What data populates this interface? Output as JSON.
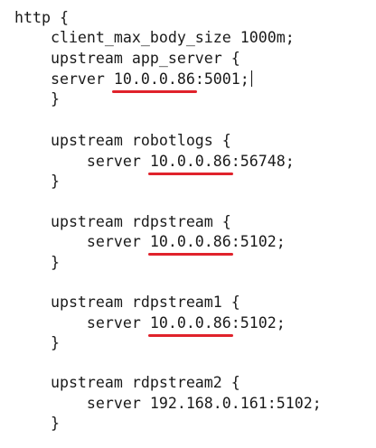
{
  "editor": {
    "lines": [
      {
        "text": "http {"
      },
      {
        "text": "    client_max_body_size 1000m;"
      },
      {
        "text": "    upstream app_server {"
      },
      {
        "pre": "    server ",
        "ip": "10.0.0.86",
        "post": ":5001;",
        "caret": true
      },
      {
        "text": "    }"
      },
      {
        "text": ""
      },
      {
        "text": "    upstream robotlogs {"
      },
      {
        "pre": "        server ",
        "ip": "10.0.0.86",
        "post": ":56748;"
      },
      {
        "text": "    }"
      },
      {
        "text": ""
      },
      {
        "text": "    upstream rdpstream {"
      },
      {
        "pre": "        server ",
        "ip": "10.0.0.86",
        "post": ":5102;"
      },
      {
        "text": "    }"
      },
      {
        "text": ""
      },
      {
        "text": "    upstream rdpstream1 {"
      },
      {
        "pre": "        server ",
        "ip": "10.0.0.86",
        "post": ":5102;"
      },
      {
        "text": "    }"
      },
      {
        "text": ""
      },
      {
        "text": "    upstream rdpstream2 {"
      },
      {
        "text": "        server 192.168.0.161:5102;"
      },
      {
        "text": "    }"
      }
    ],
    "underline_color": "#e0222b"
  }
}
